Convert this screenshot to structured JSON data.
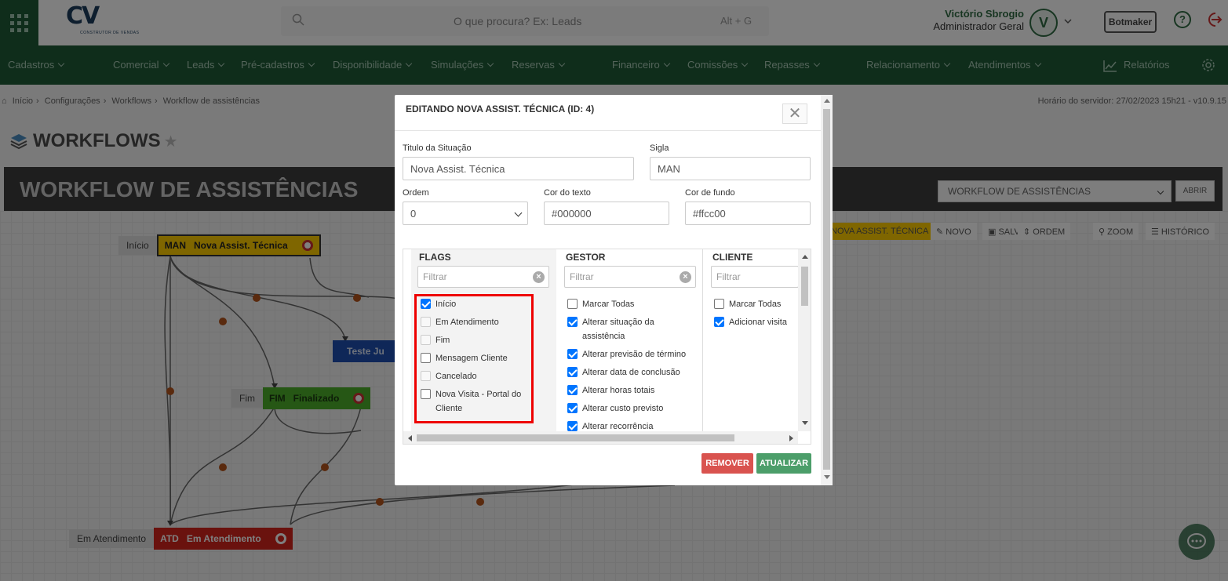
{
  "header": {
    "logo_text": "CV",
    "logo_subtitle": "CONSTRUTOR DE VENDAS",
    "search_placeholder": "O que procura? Ex: Leads",
    "search_shortcut": "Alt + G",
    "user_name": "Victório Sbrogio",
    "user_role": "Administrador Geral",
    "avatar_letter": "V",
    "botmaker_label": "Botmaker",
    "help_label": "?"
  },
  "nav": {
    "items": [
      "Cadastros",
      "Comercial",
      "Leads",
      "Pré-cadastros",
      "Disponibilidade",
      "Simulações",
      "Reservas",
      "Financeiro",
      "Comissões",
      "Repasses",
      "Relacionamento",
      "Atendimentos"
    ],
    "relatorios": "Relatórios"
  },
  "breadcrumb": [
    "Início",
    "Configurações",
    "Workflows",
    "Workflow de assistências"
  ],
  "server_time": "Horário do servidor: 27/02/2023 15h21 - v10.9.15",
  "page_title": "WORKFLOWS",
  "banner": {
    "title": "WORKFLOW DE ASSISTÊNCIAS",
    "select_value": "WORKFLOW DE ASSISTÊNCIAS",
    "abrir": "ABRIR"
  },
  "toolbar": {
    "current": "NOVA ASSIST. TÉCNICA",
    "novo": "NOVO",
    "salvar": "SALVAR",
    "ordem": "ORDEM",
    "zoom": "ZOOM",
    "historico": "HISTÓRICO"
  },
  "nodes": [
    {
      "label": "Início",
      "sigla": "MAN",
      "name": "Nova Assist. Técnica",
      "color": "#ffcc00"
    },
    {
      "label": "",
      "sigla": "",
      "name": "Teste Ju",
      "color": "#1e4fb0"
    },
    {
      "label": "Fim",
      "sigla": "FIM",
      "name": "Finalizado",
      "color": "#4caf2a"
    },
    {
      "label": "Em Atendimento",
      "sigla": "ATD",
      "name": "Em Atendimento",
      "color": "#d4251c"
    }
  ],
  "modal": {
    "title": "EDITANDO NOVA ASSIST. TÉCNICA (ID: 4)",
    "close": "✕",
    "titulo_label": "Titulo da Situação",
    "titulo_value": "Nova Assist. Técnica",
    "sigla_label": "Sigla",
    "sigla_value": "MAN",
    "ordem_label": "Ordem",
    "ordem_value": "0",
    "cor_texto_label": "Cor do texto",
    "cor_texto_value": "#000000",
    "cor_fundo_label": "Cor de fundo",
    "cor_fundo_value": "#ffcc00",
    "remover": "REMOVER",
    "atualizar": "ATUALIZAR"
  },
  "flags": {
    "header": "FLAGS",
    "filter_placeholder": "Filtrar",
    "items": [
      {
        "label": "Início",
        "state": "checked"
      },
      {
        "label": "Em Atendimento",
        "state": "disabled"
      },
      {
        "label": "Fim",
        "state": "disabled"
      },
      {
        "label": "Mensagem Cliente",
        "state": "unchecked"
      },
      {
        "label": "Cancelado",
        "state": "disabled"
      },
      {
        "label": "Nova Visita - Portal do Cliente",
        "state": "unchecked"
      }
    ]
  },
  "gestor": {
    "header": "GESTOR",
    "filter_placeholder": "Filtrar",
    "items": [
      {
        "label": "Marcar Todas",
        "state": "unchecked"
      },
      {
        "label": "Alterar situação da assistência",
        "state": "checked"
      },
      {
        "label": "Alterar previsão de término",
        "state": "checked"
      },
      {
        "label": "Alterar data de conclusão",
        "state": "checked"
      },
      {
        "label": "Alterar horas totais",
        "state": "checked"
      },
      {
        "label": "Alterar custo previsto",
        "state": "checked"
      },
      {
        "label": "Alterar recorrência",
        "state": "checked"
      }
    ]
  },
  "cliente": {
    "header": "CLIENTE",
    "filter_placeholder": "Filtrar",
    "items": [
      {
        "label": "Marcar Todas",
        "state": "unchecked"
      },
      {
        "label": "Adicionar visita",
        "state": "checked"
      }
    ]
  }
}
